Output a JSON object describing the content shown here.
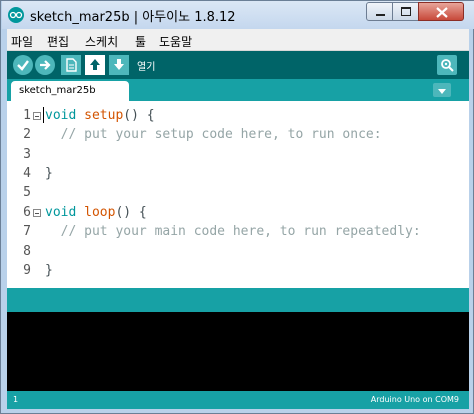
{
  "window": {
    "title": "sketch_mar25b | 아두이노 1.8.12"
  },
  "menu": {
    "items": [
      "파일",
      "편집",
      "스케치",
      "툴",
      "도움말"
    ]
  },
  "toolbar": {
    "hover_label": "열기",
    "buttons": [
      "verify-icon",
      "upload-icon",
      "new-icon",
      "open-icon",
      "save-icon"
    ],
    "monitor_icon": "serial-monitor-icon"
  },
  "tabs": {
    "active": "sketch_mar25b",
    "menu_icon": "tab-menu-icon"
  },
  "editor": {
    "line_numbers": [
      "1",
      "2",
      "3",
      "4",
      "5",
      "6",
      "7",
      "8",
      "9"
    ],
    "lines": [
      {
        "kw": "void",
        "fn": "setup",
        "rest": "() {"
      },
      {
        "comment": "  // put your setup code here, to run once:"
      },
      {
        "text": ""
      },
      {
        "text": "}"
      },
      {
        "text": ""
      },
      {
        "kw": "void",
        "fn": "loop",
        "rest": "() {"
      },
      {
        "comment": "  // put your main code here, to run repeatedly:"
      },
      {
        "text": ""
      },
      {
        "text": "}"
      }
    ]
  },
  "status": {
    "line": "1",
    "board": "Arduino Uno on COM9"
  },
  "colors": {
    "teal_dark": "#006468",
    "teal": "#17a1a5",
    "button": "#4db7bb",
    "keyword": "#00979c",
    "function": "#d35400",
    "comment": "#95a5a6"
  }
}
